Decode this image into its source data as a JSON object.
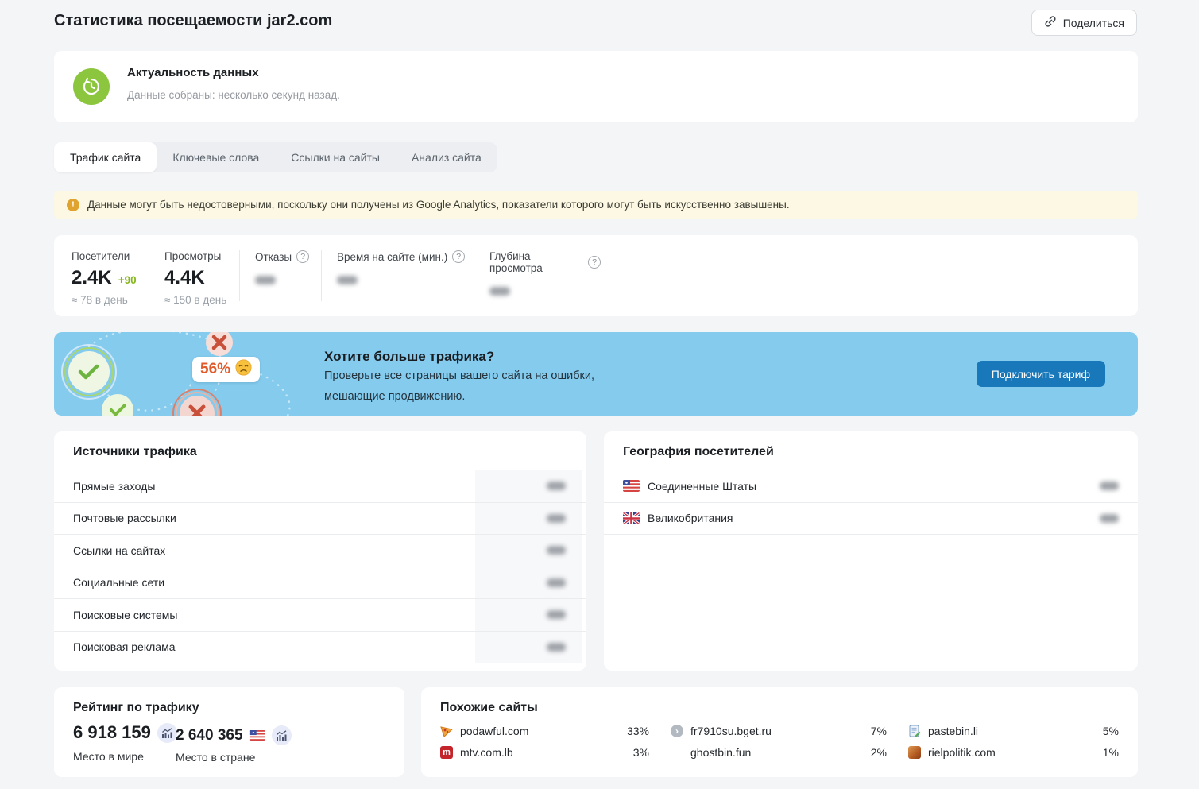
{
  "page": {
    "title": "Статистика посещаемости jar2.com"
  },
  "header": {
    "share_label": "Поделиться"
  },
  "freshness": {
    "title": "Актуальность данных",
    "subtitle": "Данные собраны: несколько секунд назад."
  },
  "tabs": [
    {
      "label": "Трафик сайта",
      "active": true
    },
    {
      "label": "Ключевые слова",
      "active": false
    },
    {
      "label": "Ссылки на сайты",
      "active": false
    },
    {
      "label": "Анализ сайта",
      "active": false
    }
  ],
  "warning": {
    "text": "Данные могут быть недостоверными, поскольку они получены из Google Analytics, показатели которого могут быть искусственно завышены."
  },
  "stats": [
    {
      "label": "Посетители",
      "value": "2.4K",
      "delta": "+90",
      "per_day": "≈ 78 в день"
    },
    {
      "label": "Просмотры",
      "value": "4.4K",
      "per_day": "≈ 150 в день"
    },
    {
      "label": "Отказы",
      "value_hidden": true
    },
    {
      "label": "Время на сайте (мин.)",
      "value_hidden": true
    },
    {
      "label": "Глубина просмотра",
      "value_hidden": true
    }
  ],
  "promo": {
    "badge_percent": "56%",
    "title": "Хотите больше трафика?",
    "line1": "Проверьте все страницы вашего сайта на ошибки,",
    "line2": "мешающие продвижению.",
    "button_label": "Подключить тариф"
  },
  "sources": {
    "title": "Источники трафика",
    "rows": [
      "Прямые заходы",
      "Почтовые рассылки",
      "Ссылки на сайтах",
      "Социальные сети",
      "Поисковые системы",
      "Поисковая реклама"
    ]
  },
  "geography": {
    "title": "География посетителей",
    "rows": [
      {
        "country": "Соединенные Штаты",
        "flag": "us"
      },
      {
        "country": "Великобритания",
        "flag": "gb"
      }
    ]
  },
  "rating": {
    "title": "Рейтинг по трафику",
    "world": {
      "value": "6 918 159",
      "label": "Место в мире"
    },
    "country": {
      "value": "2 640 365",
      "label": "Место в стране",
      "flag": "us"
    }
  },
  "similar": {
    "title": "Похожие сайты",
    "sites": [
      {
        "domain": "podawful.com",
        "percent": "33%",
        "favicon": "pizza-slice"
      },
      {
        "domain": "fr7910su.bget.ru",
        "percent": "7%",
        "favicon": "gray-chevron"
      },
      {
        "domain": "pastebin.li",
        "percent": "5%",
        "favicon": "document-pencil"
      },
      {
        "domain": "mtv.com.lb",
        "percent": "3%",
        "favicon": "red-m"
      },
      {
        "domain": "ghostbin.fun",
        "percent": "2%",
        "favicon": "none"
      },
      {
        "domain": "rielpolitik.com",
        "percent": "1%",
        "favicon": "orange-texture"
      }
    ]
  },
  "icons": {
    "help_mark": "?",
    "warning_mark": "!",
    "chevron": "›",
    "favicon_m": "m"
  },
  "colors": {
    "page_bg": "#f4f5f7",
    "accent_green": "#8cc63e",
    "delta_green": "#84b718",
    "banner_blue": "#84cbee",
    "button_blue": "#1878b9",
    "warning_bg": "#fcf8e3",
    "badge_orange": "#e05a2b",
    "check_green": "#6db33f",
    "cross_red": "#c8503a"
  }
}
